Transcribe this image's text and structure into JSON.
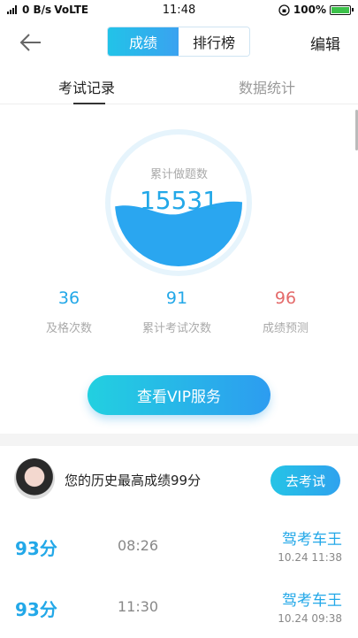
{
  "status_bar": {
    "carrier_icon": "wifi-icon",
    "speed": "0 B/s",
    "network": "VoLTE",
    "time": "11:48",
    "battery": "100%",
    "battery_level": 1.0
  },
  "header": {
    "tabs": [
      {
        "label": "成绩",
        "active": true
      },
      {
        "label": "排行榜",
        "active": false
      }
    ],
    "edit_label": "编辑"
  },
  "sub_tabs": {
    "exam_records": "考试记录",
    "data_stats": "数据统计"
  },
  "gauge": {
    "label": "累计做题数",
    "value": "15531",
    "fill_level": 0.45,
    "color": "#2aa6f0"
  },
  "stats": [
    {
      "value": "36",
      "label": "及格次数",
      "color": "#23a8e8"
    },
    {
      "value": "91",
      "label": "累计考试次数",
      "color": "#23a8e8"
    },
    {
      "value": "96",
      "label": "成绩预测",
      "color": "#e46a6a"
    }
  ],
  "vip_button": "查看VIP服务",
  "best": {
    "text": "您的历史最高成绩99分",
    "button": "去考试"
  },
  "records": [
    {
      "score": "93分",
      "duration": "08:26",
      "user": "驾考车王",
      "date": "10.24  11:38"
    },
    {
      "score": "93分",
      "duration": "11:30",
      "user": "驾考车王",
      "date": "10.24  09:38"
    }
  ]
}
